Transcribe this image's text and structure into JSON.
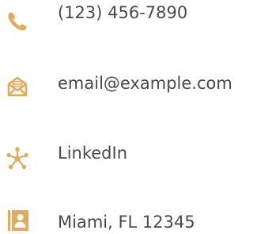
{
  "colors": {
    "icon_accent": "#E3AA5A",
    "text": "#4A4A4A",
    "background": "#FFFFFF"
  },
  "contacts": [
    {
      "icon": "phone-icon",
      "text": "(123) 456-7890"
    },
    {
      "icon": "email-icon",
      "text": "email@example.com"
    },
    {
      "icon": "network-icon",
      "text": "LinkedIn"
    },
    {
      "icon": "address-book-icon",
      "text": "Miami, FL 12345"
    }
  ]
}
